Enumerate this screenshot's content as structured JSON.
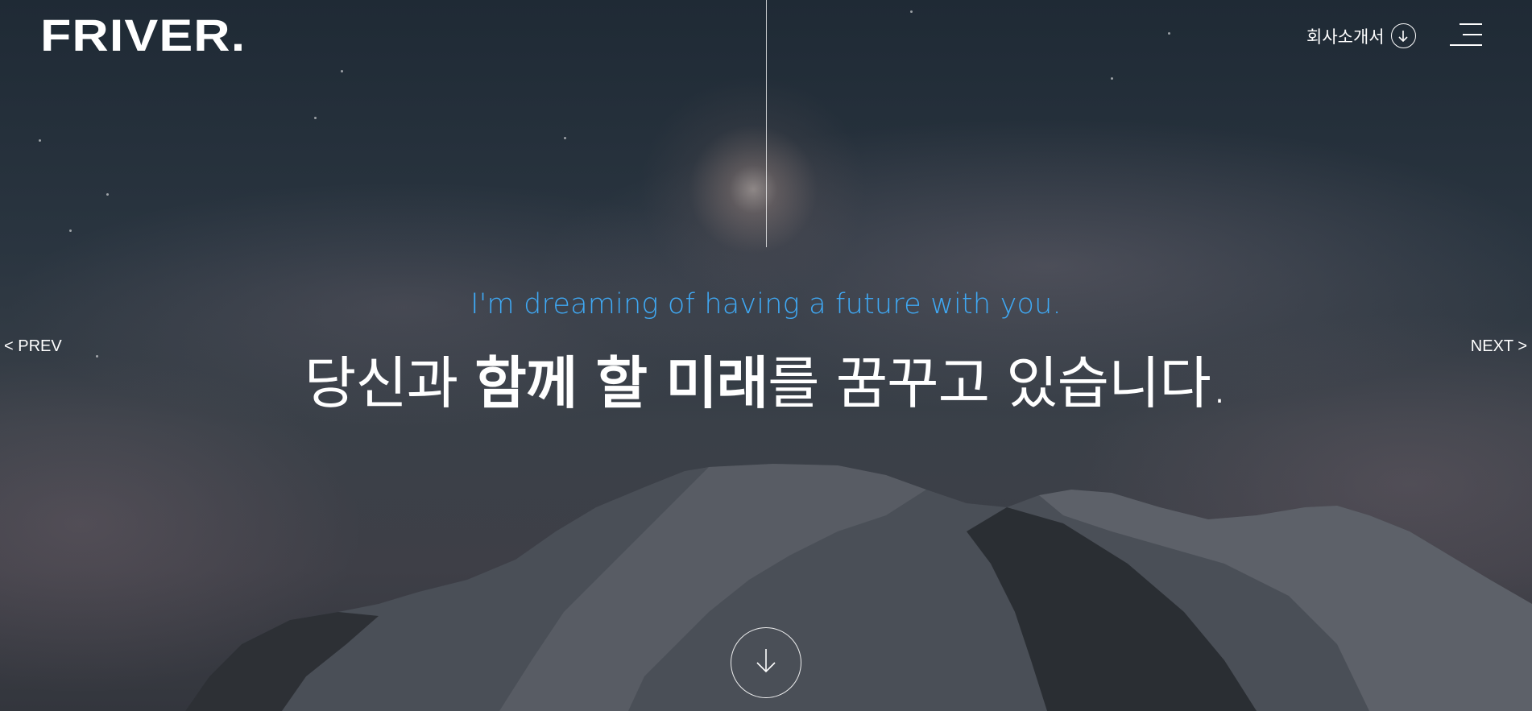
{
  "header": {
    "logo_text": "FRIVER.",
    "brochure_label": "회사소개서"
  },
  "hero": {
    "subtitle": "I'm dreaming of having a future with you.",
    "headline_part1": "당신과 ",
    "headline_bold": "함께 할 미래",
    "headline_part2": "를 꿈꾸고 있습니다."
  },
  "nav": {
    "prev_label": "< PREV",
    "next_label": "NEXT >"
  },
  "colors": {
    "accent": "#3fa9f5",
    "text": "#ffffff"
  },
  "icons": {
    "brochure": "arrow-down-circle-icon",
    "menu": "hamburger-icon",
    "scroll": "arrow-down-icon"
  }
}
